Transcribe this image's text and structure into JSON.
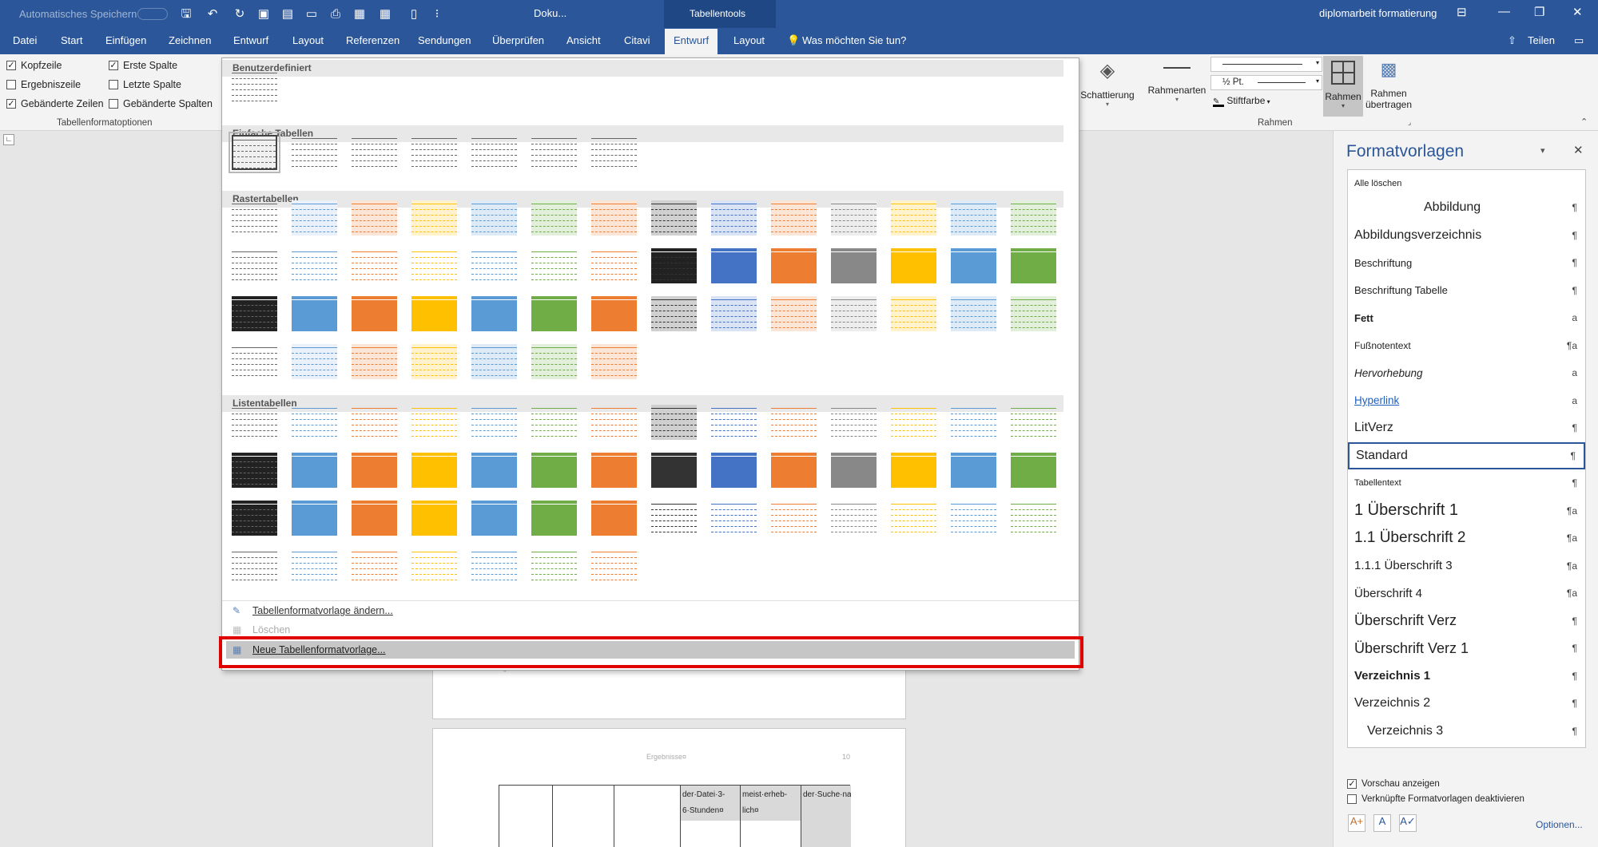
{
  "titlebar": {
    "autosave_label": "Automatisches Speichern",
    "doc_title": "Doku...",
    "context_title": "Tabellentools",
    "right_title": "diplomarbeit formatierung"
  },
  "tabs": [
    "Datei",
    "Start",
    "Einfügen",
    "Zeichnen",
    "Entwurf",
    "Layout",
    "Referenzen",
    "Sendungen",
    "Überprüfen",
    "Ansicht",
    "Citavi"
  ],
  "context_tabs": [
    "Entwurf",
    "Layout"
  ],
  "tell_me": "Was möchten Sie tun?",
  "share": "Teilen",
  "ribbon": {
    "options": [
      {
        "label": "Kopfzeile",
        "checked": true
      },
      {
        "label": "Ergebniszeile",
        "checked": false
      },
      {
        "label": "Gebänderte Zeilen",
        "checked": true
      },
      {
        "label": "Erste Spalte",
        "checked": true
      },
      {
        "label": "Letzte Spalte",
        "checked": false
      },
      {
        "label": "Gebänderte Spalten",
        "checked": false
      }
    ],
    "options_group": "Tabellenformatoptionen",
    "shading": "Schattierung",
    "border_styles": "Rahmenarten",
    "pen_weight": "½ Pt.",
    "pen_color": "Stiftfarbe",
    "borders": "Rahmen",
    "border_painter": [
      "Rahmen",
      "übertragen"
    ],
    "borders_group": "Rahmen"
  },
  "gallery": {
    "sections": [
      "Benutzerdefiniert",
      "Einfache Tabellen",
      "Rastertabellen",
      "Listentabellen"
    ],
    "menu": [
      "Tabellenformatvorlage ändern...",
      "Löschen",
      "Neue Tabellenformatvorlage..."
    ]
  },
  "document": {
    "pilcrow": "¶",
    "header_text": "Ergebnisse¤",
    "page_num": "10",
    "cells": [
      "der·Datei·3-6·Stunden¤",
      "meist·erheb-lich¤",
      "der·Suche·nach·den·richtigen·Befehlen·..."
    ]
  },
  "styles_pane": {
    "title": "Formatvorlagen",
    "clear_all": "Alle löschen",
    "items": [
      {
        "name": "Abbildung",
        "mark": "¶"
      },
      {
        "name": "Abbildungsverzeichnis",
        "mark": "¶"
      },
      {
        "name": "Beschriftung",
        "mark": "¶"
      },
      {
        "name": "Beschriftung Tabelle",
        "mark": "¶"
      },
      {
        "name": "Fett",
        "mark": "a"
      },
      {
        "name": "Fußnotentext",
        "mark": "¶a"
      },
      {
        "name": "Hervorhebung",
        "mark": "a"
      },
      {
        "name": "Hyperlink",
        "mark": "a"
      },
      {
        "name": "LitVerz",
        "mark": "¶"
      },
      {
        "name": "Standard",
        "mark": "¶"
      },
      {
        "name": "Tabellentext",
        "mark": "¶"
      },
      {
        "name": "1  Überschrift 1",
        "mark": "¶a"
      },
      {
        "name": "1.1  Überschrift 2",
        "mark": "¶a"
      },
      {
        "name": "1.1.1  Überschrift 3",
        "mark": "¶a"
      },
      {
        "name": "Überschrift 4",
        "mark": "¶a"
      },
      {
        "name": "Überschrift Verz",
        "mark": "¶"
      },
      {
        "name": "Überschrift Verz 1",
        "mark": "¶"
      },
      {
        "name": "Verzeichnis 1",
        "mark": "¶"
      },
      {
        "name": "Verzeichnis 2",
        "mark": "¶"
      },
      {
        "name": "Verzeichnis 3",
        "mark": "¶"
      }
    ],
    "preview": "Vorschau anzeigen",
    "linked": "Verknüpfte Formatvorlagen deaktivieren",
    "options": "Optionen..."
  },
  "colors": {
    "word_blue": "#2b579a",
    "highlight": "#e00000",
    "palette": [
      "#7f7f7f",
      "#5b9bd5",
      "#ed7d31",
      "#a5a5a5",
      "#ffc000",
      "#4472c4",
      "#70ad47"
    ]
  }
}
